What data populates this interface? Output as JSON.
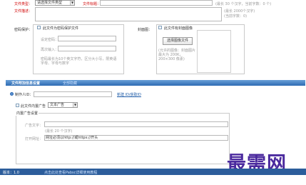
{
  "top": {
    "category_label": "文件类型：",
    "category_value": "请选择文件类型",
    "title_label": "文件标题：",
    "title_hint": "(最长 30 个汉字，当前字数：0 个)",
    "desc_label": "文件描述：",
    "desc_hint1": "(最长 2000个汉字)",
    "desc_hint2": "(当前字数：0)"
  },
  "password": {
    "section_label": "密码保护：",
    "checkbox_label": "此文件为密码保护文件",
    "set_label": "设定密码：",
    "repeat_label": "再次输入：",
    "note": "密码最长为10个英文字符，区分大小写，限英语字母、字母与数字"
  },
  "cover": {
    "section_label": "封面图：",
    "checkbox_label": "此文件有封面图像",
    "button_label": "选择图像文件",
    "note": "(允许的图像：封面图片最大为 200K，200×300 像素)"
  },
  "extra": {
    "header": "文件附加信息设置",
    "header_link": "全部隐藏",
    "author_label": "制作人ID：",
    "author_link": "新建 ID/获取ID",
    "ad_checkbox_label": "此文件内置广告",
    "ad_type_value": "文本广告",
    "ad_settings_title": "内置广告设置",
    "ad_text_label": "广告文字：",
    "ad_text_hint": "(最长 20 个汉字)",
    "ad_url_label": "打开网址：",
    "ad_url_value": "网址必须以http://或https://开头"
  },
  "status": {
    "version": "版本：1.0",
    "link": "点击此处查看Pabsc详细使用教程"
  },
  "watermark": "最需网"
}
